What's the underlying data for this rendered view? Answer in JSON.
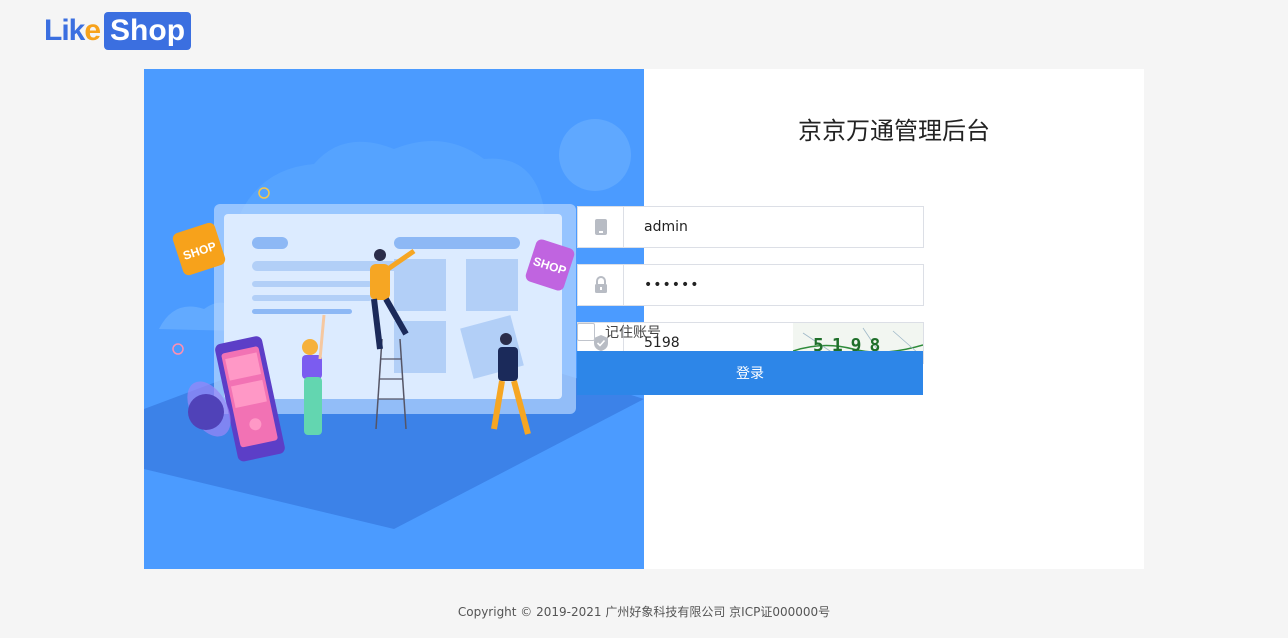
{
  "logo": {
    "part1": "Lik",
    "part1_accent": "e",
    "part2": "Shop"
  },
  "form": {
    "title": "京京万通管理后台",
    "username": "admin",
    "password": "••••••",
    "captcha_value": "5198",
    "captcha_image_text": "5198",
    "remember_label": "记住账号",
    "login_button": "登录"
  },
  "illustration": {
    "badge_left": "SHOP",
    "badge_right": "SHOP"
  },
  "footer": {
    "copyright": "Copyright © 2019-2021 广州好象科技有限公司  京ICP证000000号"
  },
  "colors": {
    "accent": "#2d86e8",
    "illustration_bg": "#4b9bff",
    "logo_blue": "#3b6fe0",
    "logo_orange": "#f7a21b"
  }
}
